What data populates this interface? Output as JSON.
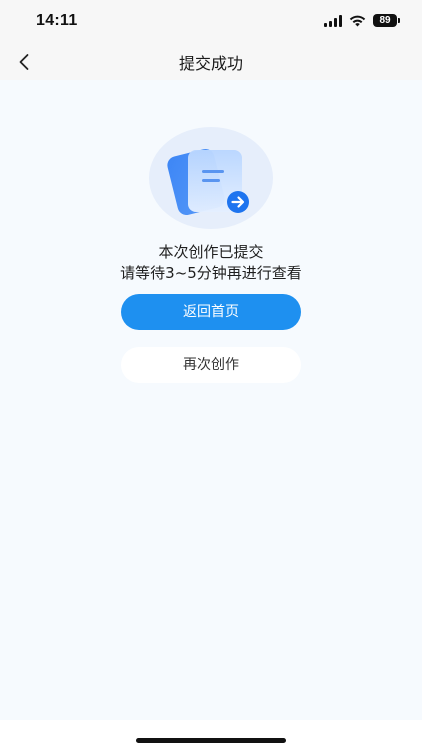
{
  "status_bar": {
    "time": "14:11",
    "battery": "89",
    "icons": [
      "signal-icon",
      "wifi-icon",
      "battery-icon"
    ]
  },
  "nav": {
    "title": "提交成功",
    "back_icon": "chevron-left-icon"
  },
  "content": {
    "illustration_icon": "document-submitted-icon",
    "message_line1": "本次创作已提交",
    "message_line2": "请等待3~5分钟再进行查看",
    "primary_button_label": "返回首页",
    "secondary_button_label": "再次创作"
  },
  "colors": {
    "accent": "#1e90f0",
    "content_background": "#f6fafe",
    "nav_background": "#f7f7f7"
  }
}
